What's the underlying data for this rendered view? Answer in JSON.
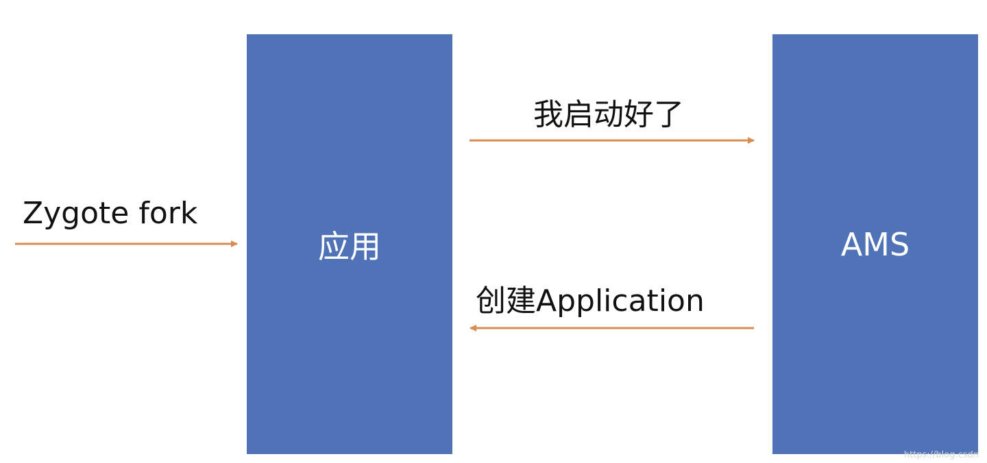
{
  "nodes": {
    "app": "应用",
    "ams": "AMS"
  },
  "edges": {
    "zygote_fork": "Zygote fork",
    "started": "我启动好了",
    "create_application": "创建Application"
  },
  "colors": {
    "block": "#5073b8",
    "arrow": "#d98c4f",
    "text": "#111111"
  },
  "watermark": "https://blog.csdn"
}
